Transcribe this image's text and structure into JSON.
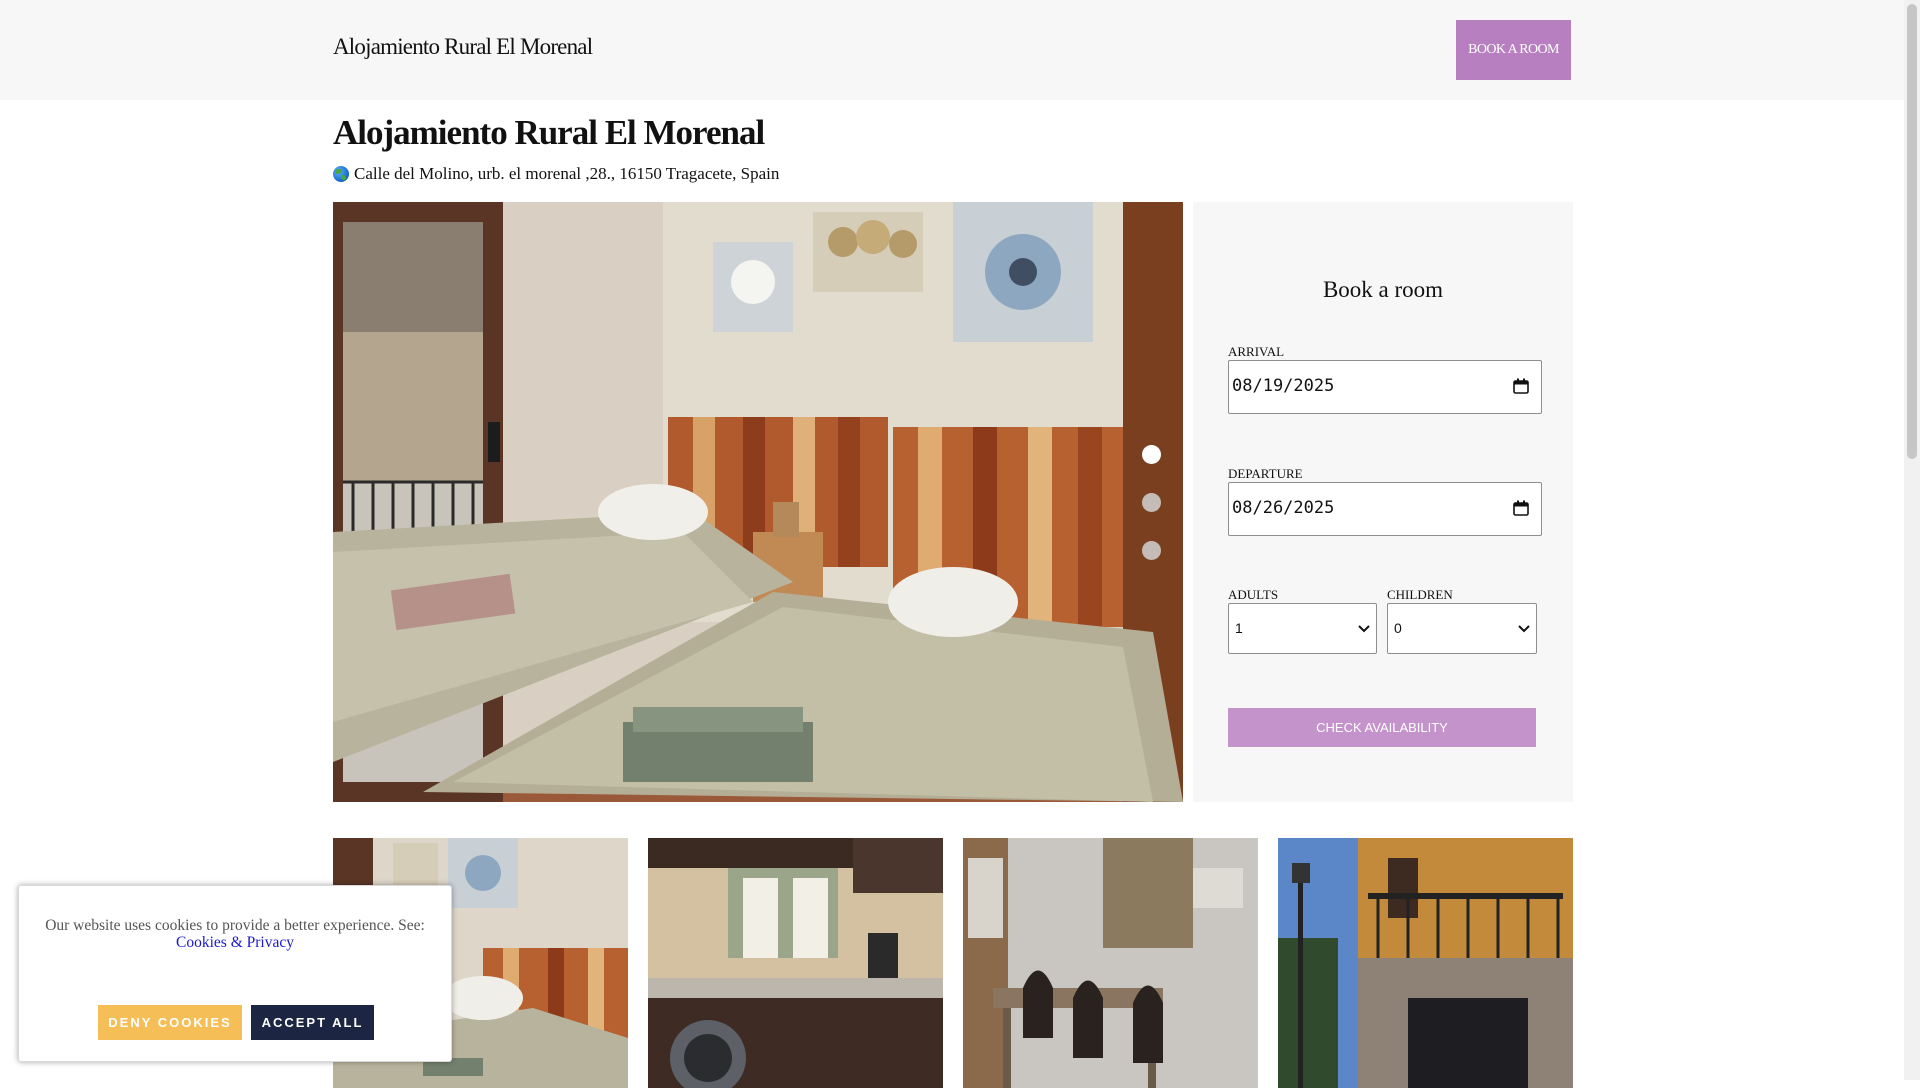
{
  "header": {
    "brand": "Alojamiento Rural El Morenal",
    "book_button": "BOOK A ROOM",
    "brand_color": "#b77fbf"
  },
  "property": {
    "title": "Alojamiento Rural El Morenal",
    "address_icon": "globe-icon",
    "address": "Calle del Molino, urb. el morenal ,28., 16150 Tragacete, Spain"
  },
  "gallery": {
    "slides_total": 3,
    "active_slide": 1,
    "thumbnails": [
      {
        "subject": "bedroom"
      },
      {
        "subject": "kitchen"
      },
      {
        "subject": "dining"
      },
      {
        "subject": "exterior"
      }
    ]
  },
  "booking": {
    "title": "Book a room",
    "arrival_label": "ARRIVAL",
    "arrival_value": "08/19/2025",
    "departure_label": "DEPARTURE",
    "departure_value": "08/26/2025",
    "adults_label": "ADULTS",
    "adults_value": "1",
    "children_label": "CHILDREN",
    "children_value": "0",
    "check_button": "CHECK AVAILABILITY",
    "button_color": "#c593cb"
  },
  "cookie_banner": {
    "message": "Our website uses cookies to provide a better experience. See:",
    "link_text": "Cookies & Privacy",
    "deny_button": "DENY COOKIES",
    "accept_button": "ACCEPT ALL",
    "deny_color": "#f6be56",
    "accept_color": "#1c2541"
  }
}
